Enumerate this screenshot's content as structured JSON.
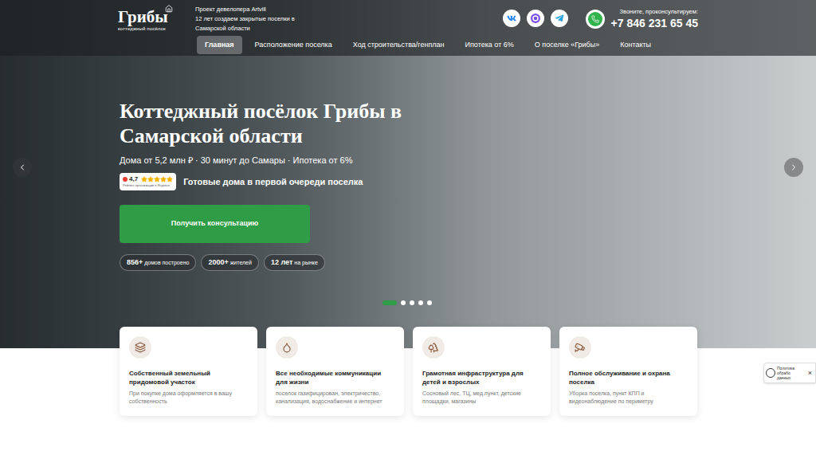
{
  "header": {
    "logo": {
      "name": "Грибы",
      "subtitle": "коттеджный посёлок"
    },
    "developer_lines": [
      "Проект девелопера Artvill",
      "12 лет создаем закрытые поселки в",
      "Самарской области"
    ],
    "contact": {
      "label": "Звоните, проконсультируем:",
      "phone": "+7 846 231 65 45"
    }
  },
  "nav": [
    {
      "label": "Главная",
      "selected": true
    },
    {
      "label": "Расположение поселка",
      "selected": false
    },
    {
      "label": "Ход строительства/генплан",
      "selected": false
    },
    {
      "label": "Ипотека от 6%",
      "selected": false
    },
    {
      "label": "О поселке «Грибы»",
      "selected": false
    },
    {
      "label": "Контакты",
      "selected": false
    }
  ],
  "hero": {
    "title": "Коттеджный посёлок Грибы в Самарской области",
    "subtitle": "Дома от 5,2 млн ₽ · 30 минут до Самары · Ипотека от 6%",
    "rating": {
      "value": "4,7",
      "stars": 5,
      "caption": "Рейтинг организации в Яндексе"
    },
    "highlight": "Готовые дома в первой очереди поселка",
    "cta": "Получить консультацию",
    "stats": [
      {
        "value": "856+",
        "label": "домов построено"
      },
      {
        "value": "2000+",
        "label": "жителей"
      },
      {
        "value": "12 лет",
        "label": "на рынке"
      }
    ],
    "slides": [
      {
        "selected": true
      },
      {
        "selected": false
      },
      {
        "selected": false
      },
      {
        "selected": false
      },
      {
        "selected": false
      }
    ]
  },
  "features": [
    {
      "title": "Собственный земельный придомовой участок",
      "description": "При покупке дома оформляется в вашу собственность"
    },
    {
      "title": "Все необходимые коммуникации для жизни",
      "description": "поселок газифицирован, электричество, канализация, водоснабжение и интернет"
    },
    {
      "title": "Грамотная инфраструктура для детей и взрослых",
      "description": "Сосновый лес, ТЦ, мед.пункт, детские площадки, магазины"
    },
    {
      "title": "Полное обслуживание и охрана поселка",
      "description": "Уборка поселка, пункт КПП и видеонаблюдение по периметру"
    }
  ],
  "cookie": {
    "text": "Политика обрабо данных",
    "close": "×"
  }
}
